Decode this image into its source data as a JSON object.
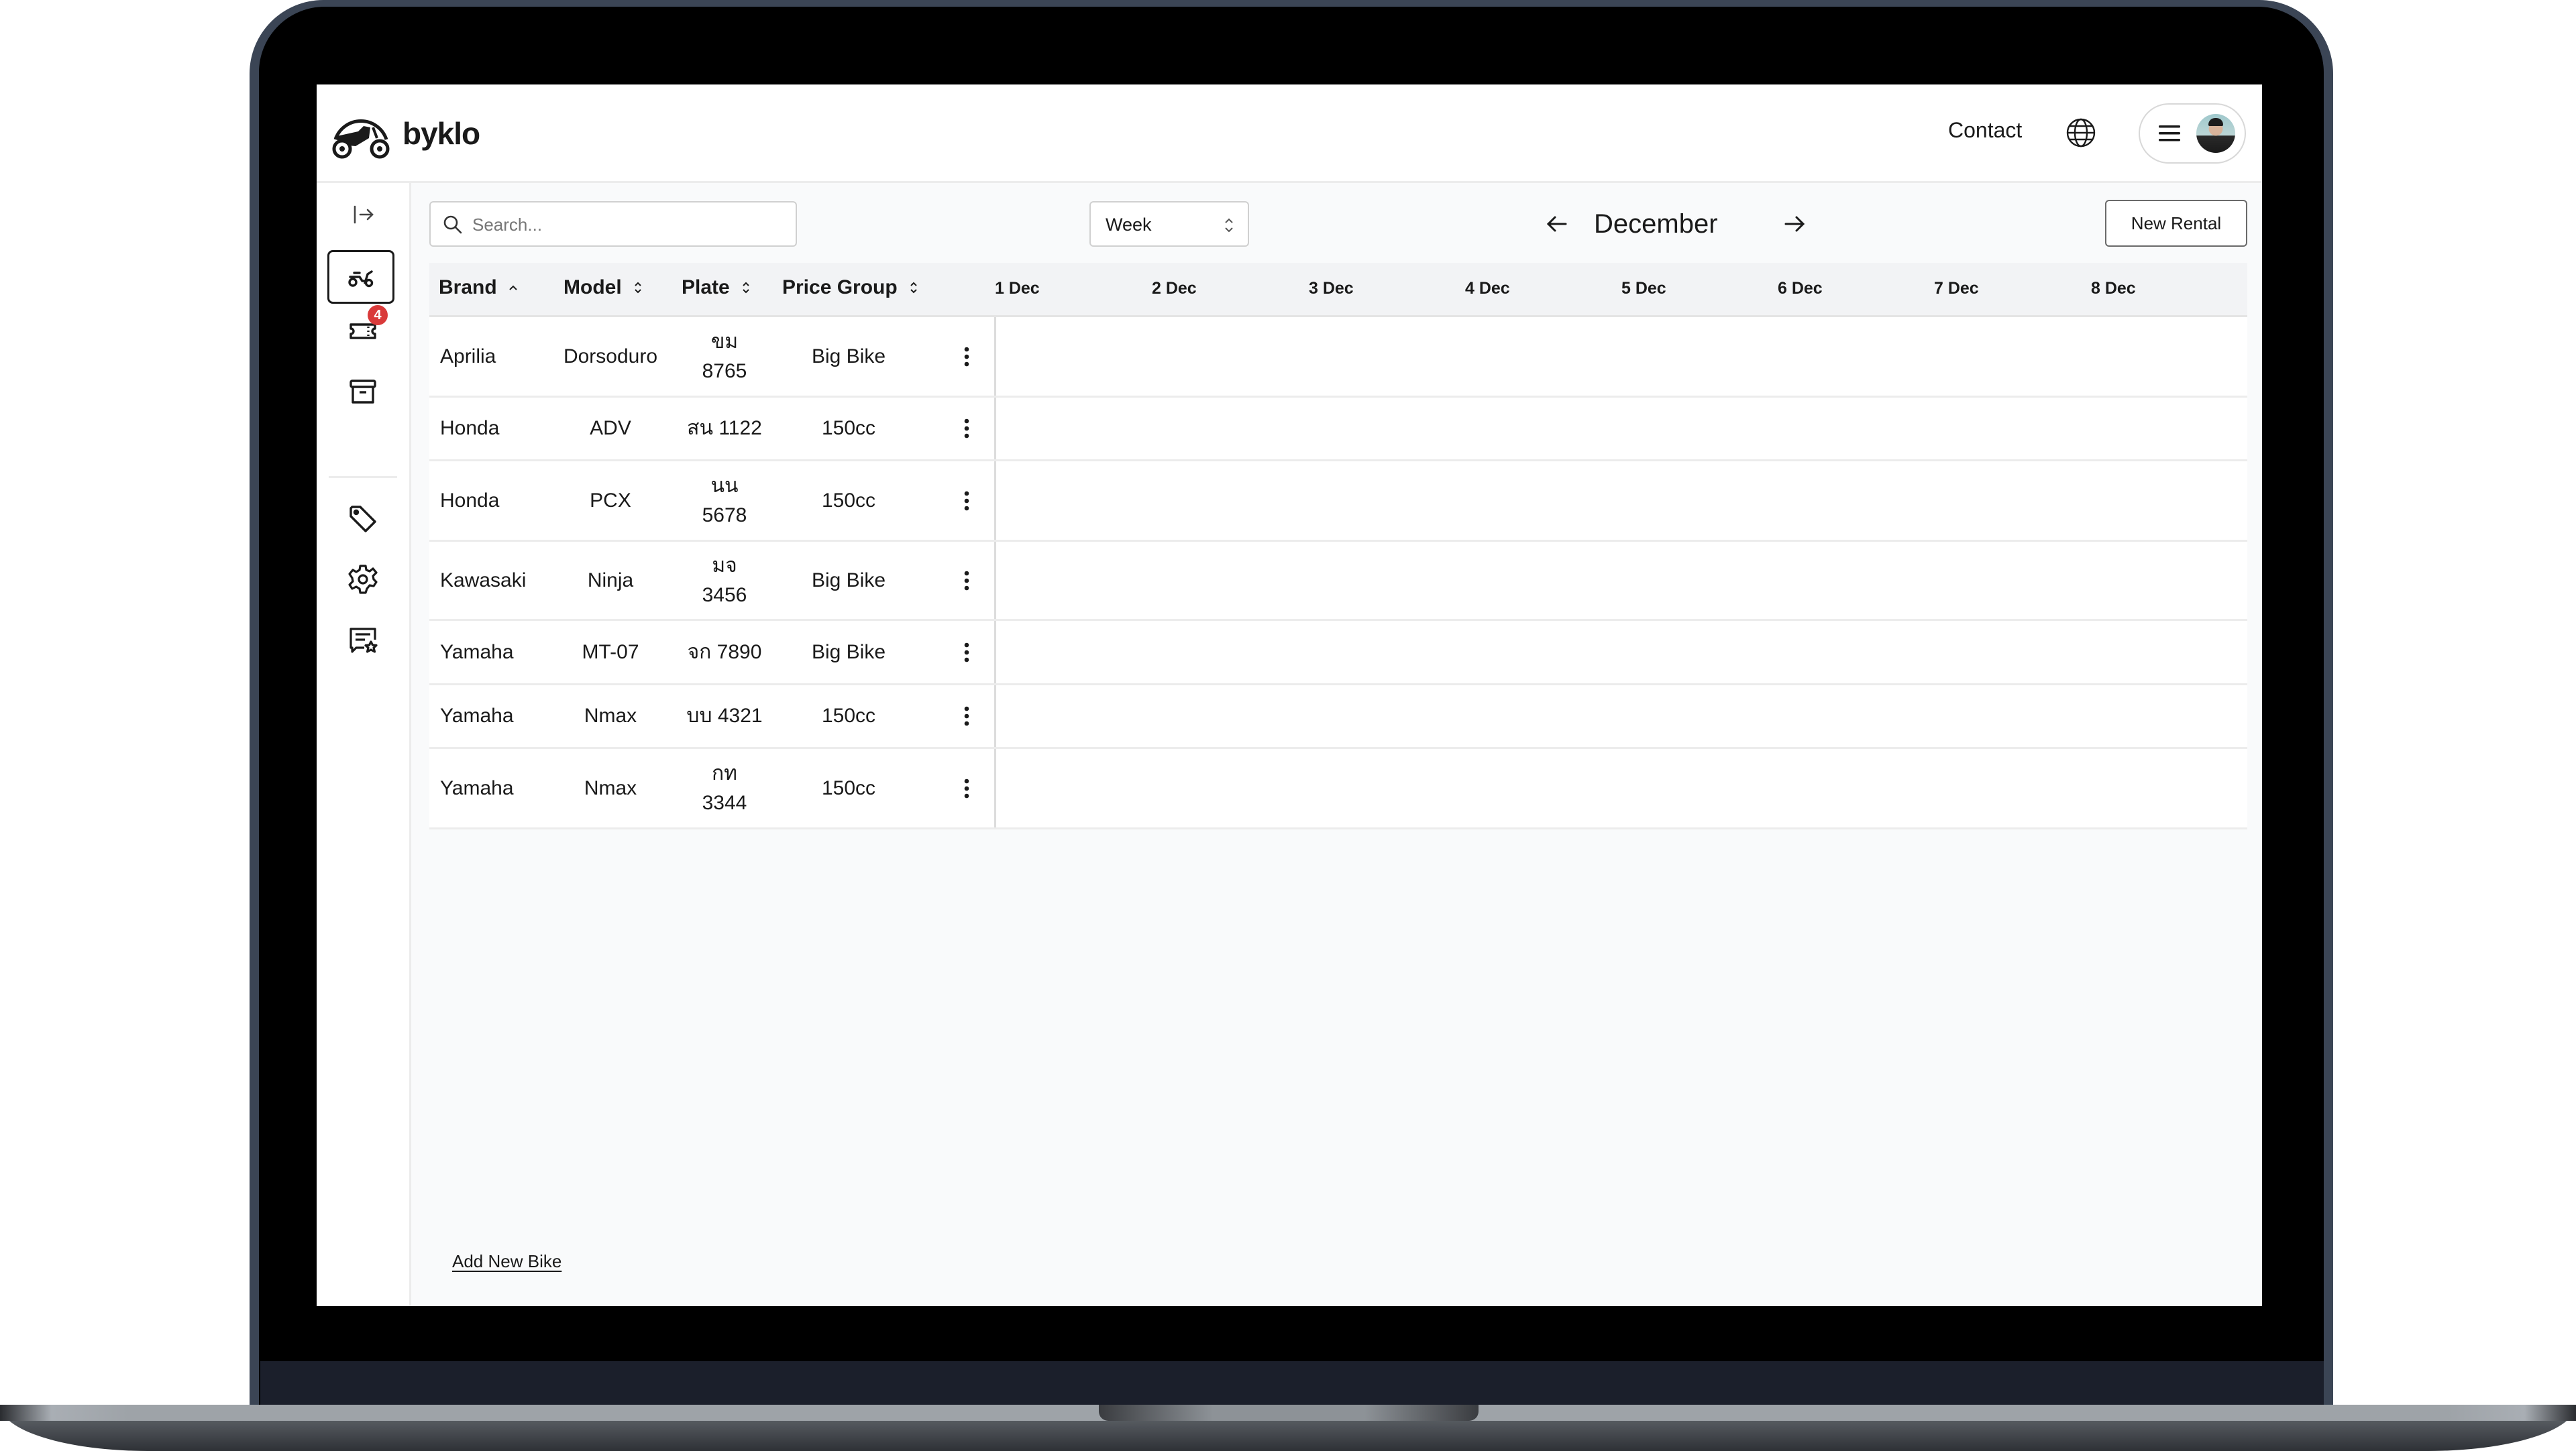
{
  "app": {
    "brand_name": "byklo",
    "logo_icon": "motorcycle-logo-icon"
  },
  "header": {
    "contact_label": "Contact",
    "language_icon": "globe-icon",
    "menu_icon": "hamburger-menu-icon",
    "avatar_icon": "user-avatar"
  },
  "sidebar": {
    "collapse_icon": "expand-sidebar-icon",
    "items": [
      {
        "name": "bikes",
        "icon": "scooter-icon",
        "active": true
      },
      {
        "name": "rentals",
        "icon": "ticket-icon",
        "badge": "4"
      },
      {
        "name": "archive",
        "icon": "archive-box-icon"
      },
      {
        "name": "pricing",
        "icon": "price-tag-icon"
      },
      {
        "name": "settings",
        "icon": "gear-icon"
      },
      {
        "name": "reviews",
        "icon": "feedback-star-icon"
      }
    ]
  },
  "toolbar": {
    "search_placeholder": "Search...",
    "search_value": "",
    "view_select_value": "Week",
    "month_label": "December",
    "prev_icon": "arrow-left-icon",
    "next_icon": "arrow-right-icon",
    "new_rental_label": "New Rental"
  },
  "table": {
    "columns": [
      {
        "label": "Brand",
        "sort": "ascending"
      },
      {
        "label": "Model",
        "sort": "none"
      },
      {
        "label": "Plate",
        "sort": "none"
      },
      {
        "label": "Price Group",
        "sort": "none"
      }
    ],
    "days": [
      "1 Dec",
      "2 Dec",
      "3 Dec",
      "4 Dec",
      "5 Dec",
      "6 Dec",
      "7 Dec",
      "8 Dec"
    ],
    "rows": [
      {
        "brand": "Aprilia",
        "model": "Dorsoduro",
        "plate_prefix": "ขม",
        "plate_number": "8765",
        "price_group": "Big Bike"
      },
      {
        "brand": "Honda",
        "model": "ADV",
        "plate_prefix": "สน",
        "plate_number": "1122",
        "price_group": "150cc"
      },
      {
        "brand": "Honda",
        "model": "PCX",
        "plate_prefix": "นน",
        "plate_number": "5678",
        "price_group": "150cc"
      },
      {
        "brand": "Kawasaki",
        "model": "Ninja",
        "plate_prefix": "มจ",
        "plate_number": "3456",
        "price_group": "Big Bike"
      },
      {
        "brand": "Yamaha",
        "model": "MT-07",
        "plate_prefix": "จก",
        "plate_number": "7890",
        "price_group": "Big Bike"
      },
      {
        "brand": "Yamaha",
        "model": "Nmax",
        "plate_prefix": "บบ",
        "plate_number": "4321",
        "price_group": "150cc"
      },
      {
        "brand": "Yamaha",
        "model": "Nmax",
        "plate_prefix": "กท",
        "plate_number": "3344",
        "price_group": "150cc"
      }
    ]
  },
  "footer": {
    "add_bike_label": "Add New Bike"
  },
  "colors": {
    "badge": "#d93a3a",
    "text": "#1a1a1a",
    "page_bg": "#f9fafb",
    "header_row_bg": "#f2f3f5"
  }
}
